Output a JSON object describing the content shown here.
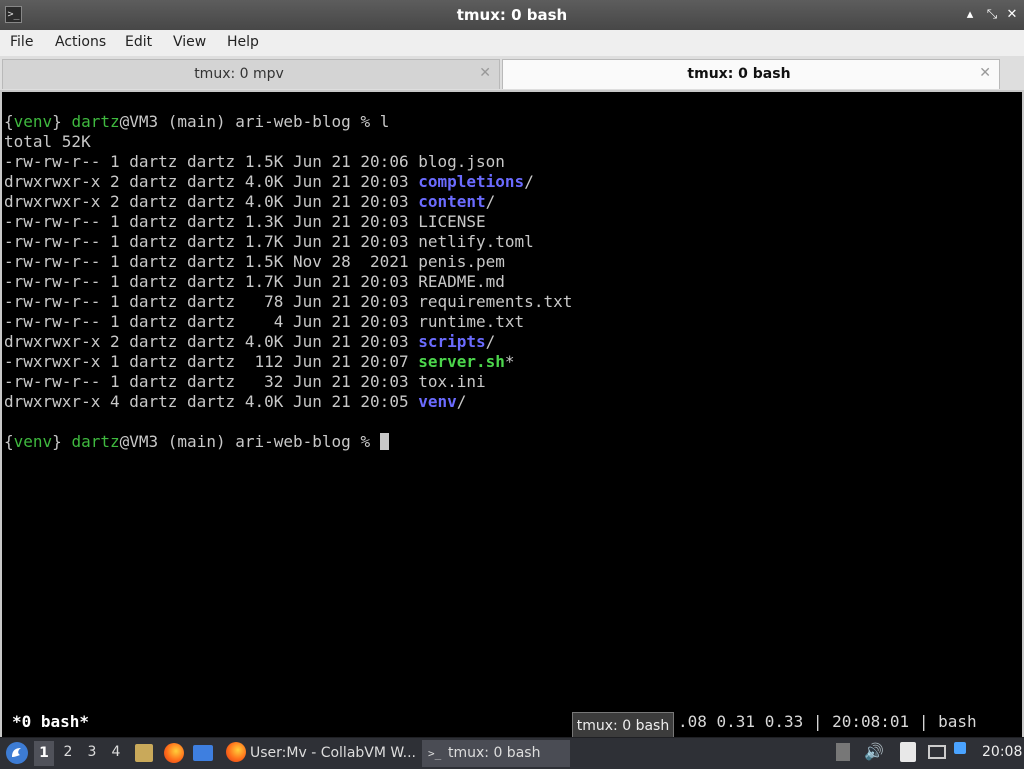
{
  "window": {
    "title": "tmux: 0 bash",
    "icon": "terminal-icon",
    "minimize": "▴",
    "maximize": "▴",
    "close": "✕"
  },
  "menu": [
    "File",
    "Actions",
    "Edit",
    "View",
    "Help"
  ],
  "tabs": [
    {
      "label": "tmux: 0 mpv",
      "close": "✕"
    },
    {
      "label": "tmux: 0 bash",
      "close": "✕"
    }
  ],
  "terminal": {
    "prompt": {
      "venv_open": "{",
      "venv": "venv",
      "venv_close": "}",
      "user": "dartz",
      "host": "@VM3 (main) ari-web-blog % ",
      "command1": "l",
      "command2": ""
    },
    "total": "total 52K",
    "listing": [
      {
        "meta": "-rw-rw-r-- 1 dartz dartz 1.5K Jun 21 20:06 ",
        "name": "blog.json",
        "suffix": "",
        "kind": "file"
      },
      {
        "meta": "drwxrwxr-x 2 dartz dartz 4.0K Jun 21 20:03 ",
        "name": "completions",
        "suffix": "/",
        "kind": "dir"
      },
      {
        "meta": "drwxrwxr-x 2 dartz dartz 4.0K Jun 21 20:03 ",
        "name": "content",
        "suffix": "/",
        "kind": "dir"
      },
      {
        "meta": "-rw-rw-r-- 1 dartz dartz 1.3K Jun 21 20:03 ",
        "name": "LICENSE",
        "suffix": "",
        "kind": "file"
      },
      {
        "meta": "-rw-rw-r-- 1 dartz dartz 1.7K Jun 21 20:03 ",
        "name": "netlify.toml",
        "suffix": "",
        "kind": "file"
      },
      {
        "meta": "-rw-rw-r-- 1 dartz dartz 1.5K Nov 28  2021 ",
        "name": "penis.pem",
        "suffix": "",
        "kind": "file"
      },
      {
        "meta": "-rw-rw-r-- 1 dartz dartz 1.7K Jun 21 20:03 ",
        "name": "README.md",
        "suffix": "",
        "kind": "file"
      },
      {
        "meta": "-rw-rw-r-- 1 dartz dartz   78 Jun 21 20:03 ",
        "name": "requirements.txt",
        "suffix": "",
        "kind": "file"
      },
      {
        "meta": "-rw-rw-r-- 1 dartz dartz    4 Jun 21 20:03 ",
        "name": "runtime.txt",
        "suffix": "",
        "kind": "file"
      },
      {
        "meta": "drwxrwxr-x 2 dartz dartz 4.0K Jun 21 20:03 ",
        "name": "scripts",
        "suffix": "/",
        "kind": "dir"
      },
      {
        "meta": "-rwxrwxr-x 1 dartz dartz  112 Jun 21 20:07 ",
        "name": "server.sh",
        "suffix": "*",
        "kind": "exe"
      },
      {
        "meta": "-rw-rw-r-- 1 dartz dartz   32 Jun 21 20:03 ",
        "name": "tox.ini",
        "suffix": "",
        "kind": "file"
      },
      {
        "meta": "drwxrwxr-x 4 dartz dartz 4.0K Jun 21 20:05 ",
        "name": "venv",
        "suffix": "/",
        "kind": "dir"
      }
    ],
    "status_left": "*0 bash*",
    "status_right": ".08 0.31 0.33 | 20:08:01 | bash"
  },
  "tooltip": "tmux: 0 bash",
  "taskbar": {
    "workspaces": [
      "1",
      "2",
      "3",
      "4"
    ],
    "tasks": [
      {
        "label": "User:Mv - CollabVM W...",
        "icon": "firefox-icon"
      },
      {
        "label": "tmux: 0 bash",
        "icon": "terminal-icon"
      }
    ],
    "clock": "20:08"
  }
}
